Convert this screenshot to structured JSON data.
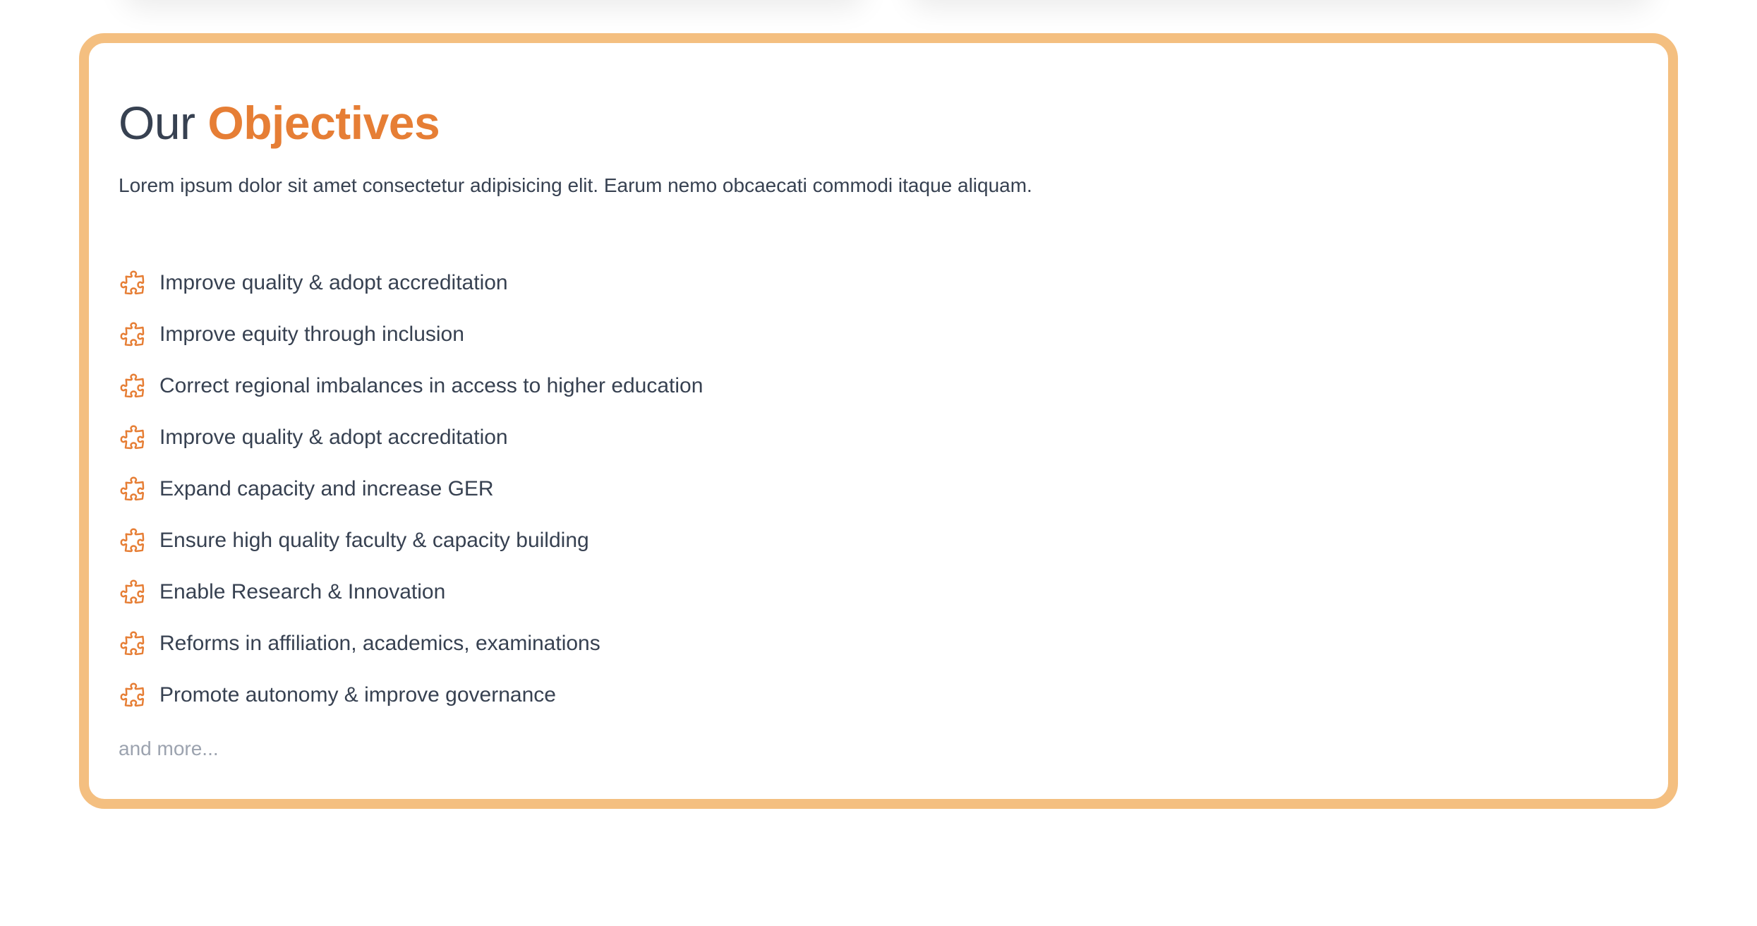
{
  "section": {
    "title_prefix": "Our",
    "title_accent": "Objectives",
    "intro": "Lorem ipsum dolor sit amet consectetur adipisicing elit. Earum nemo obcaecati commodi itaque aliquam.",
    "more_text": "and more...",
    "icon": "puzzle-piece-icon",
    "colors": {
      "accent": "#e67e35",
      "border": "#f4bf80",
      "text": "#374151",
      "muted": "#9ca3af"
    }
  },
  "objectives": [
    {
      "label": "Improve quality & adopt accreditation"
    },
    {
      "label": "Improve equity through inclusion"
    },
    {
      "label": "Correct regional imbalances in access to higher education"
    },
    {
      "label": "Improve quality & adopt accreditation"
    },
    {
      "label": "Expand capacity and increase GER"
    },
    {
      "label": "Ensure high quality faculty & capacity building"
    },
    {
      "label": "Enable Research & Innovation"
    },
    {
      "label": "Reforms in affiliation, academics, examinations"
    },
    {
      "label": "Promote autonomy & improve governance"
    }
  ]
}
